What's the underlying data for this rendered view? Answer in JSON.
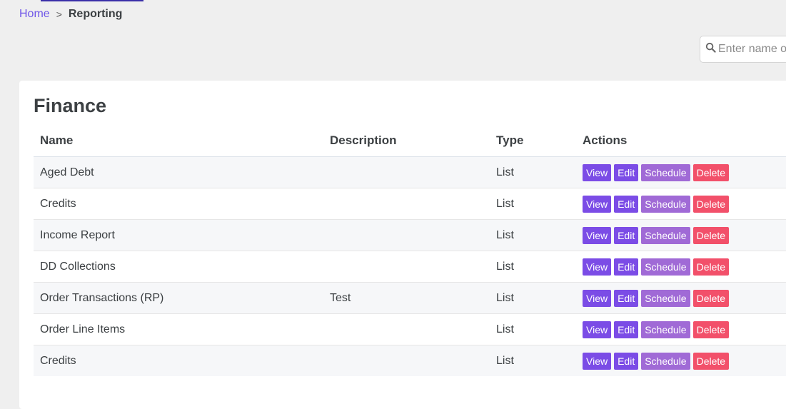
{
  "breadcrumb": {
    "home": "Home",
    "separator": ">",
    "current": "Reporting"
  },
  "search": {
    "placeholder": "Enter name or",
    "icon": "search-icon"
  },
  "section": {
    "title": "Finance",
    "columns": [
      "Name",
      "Description",
      "Type",
      "Actions"
    ],
    "rows": [
      {
        "name": "Aged Debt",
        "description": "",
        "type": "List"
      },
      {
        "name": "Credits",
        "description": "",
        "type": "List"
      },
      {
        "name": "Income Report",
        "description": "",
        "type": "List"
      },
      {
        "name": "DD Collections",
        "description": "",
        "type": "List"
      },
      {
        "name": "Order Transactions (RP)",
        "description": "Test",
        "type": "List"
      },
      {
        "name": "Order Line Items",
        "description": "",
        "type": "List"
      },
      {
        "name": "Credits",
        "description": "",
        "type": "List"
      }
    ],
    "actions": {
      "view": "View",
      "edit": "Edit",
      "schedule": "Schedule",
      "delete": "Delete"
    }
  },
  "colors": {
    "accent": "#6f56e8",
    "view": "#7b4ce6",
    "edit": "#7b4ce6",
    "schedule": "#a06ad6",
    "delete": "#f2506a"
  }
}
